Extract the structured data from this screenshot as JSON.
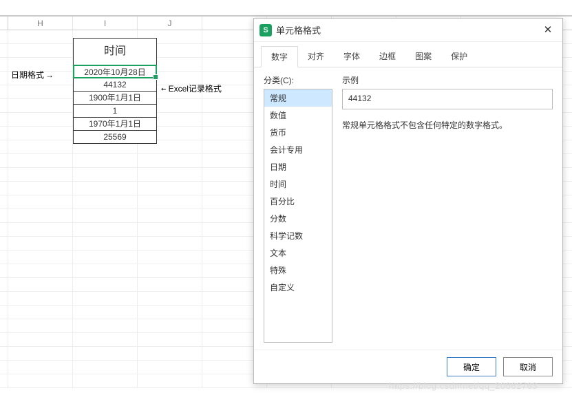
{
  "sheet": {
    "columns": [
      "H",
      "I",
      "J"
    ],
    "empty_cols": 4
  },
  "datablock": {
    "header": "时间",
    "rows": [
      "2020年10月28日",
      "44132",
      "1900年1月1日",
      "1",
      "1970年1月1日",
      "25569"
    ],
    "selected_row_index": 0
  },
  "annotations": {
    "left": "日期格式",
    "right_arrow": "←",
    "right_text": "Excel记录格式"
  },
  "dialog": {
    "title": "单元格格式",
    "app_icon_letter": "S",
    "tabs": [
      "数字",
      "对齐",
      "字体",
      "边框",
      "图案",
      "保护"
    ],
    "active_tab_index": 0,
    "category_label": "分类(C):",
    "categories": [
      "常规",
      "数值",
      "货币",
      "会计专用",
      "日期",
      "时间",
      "百分比",
      "分数",
      "科学记数",
      "文本",
      "特殊",
      "自定义"
    ],
    "selected_category_index": 0,
    "sample_label": "示例",
    "sample_value": "44132",
    "description": "常规单元格格式不包含任何特定的数字格式。",
    "ok_label": "确定",
    "cancel_label": "取消"
  },
  "watermark": "https://blog.csdn.net/qq_20662763"
}
